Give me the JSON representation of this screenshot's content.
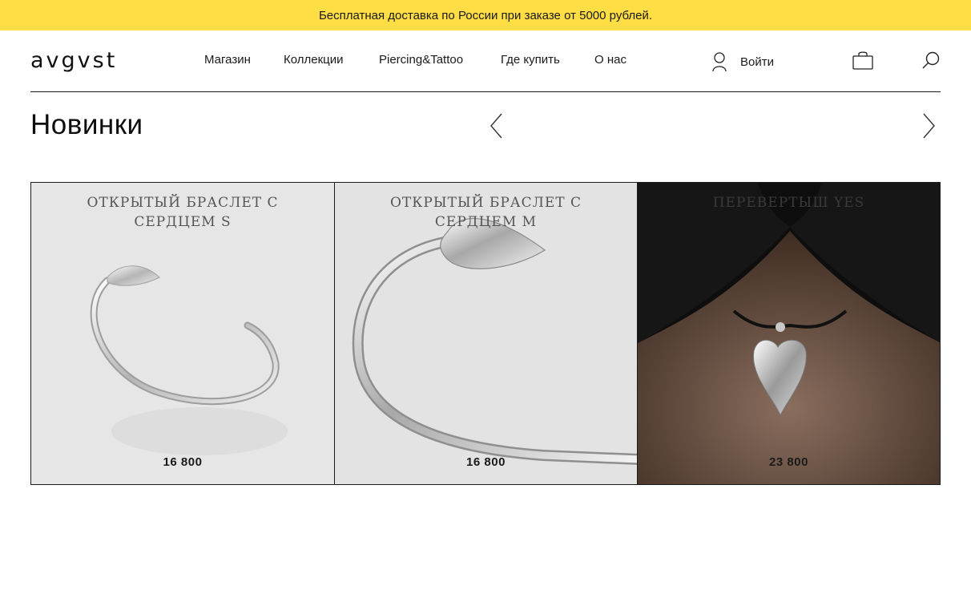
{
  "promo": {
    "text": "Бесплатная доставка по России при заказе от 5000 рублей."
  },
  "header": {
    "logo": "avgvst",
    "nav": [
      {
        "label": "Магазин"
      },
      {
        "label": "Коллекции"
      },
      {
        "label": "Piercing&Tattoo"
      },
      {
        "label": "Где купить"
      },
      {
        "label": "О нас"
      }
    ],
    "login_label": "Войти",
    "icons": {
      "user": "user-icon",
      "cart": "shopping-bag-icon",
      "search": "search-icon"
    }
  },
  "section": {
    "title": "Новинки",
    "prev_icon": "chevron-left-icon",
    "next_icon": "chevron-right-icon"
  },
  "products": [
    {
      "title": "Открытый браслет с сердцем S",
      "price": "16 800",
      "image": "silver-heart-cuff-bracelet"
    },
    {
      "title": "Открытый браслет с сердцем M",
      "price": "16 800",
      "image": "silver-heart-cuff-bracelet-closeup"
    },
    {
      "title": "Перевертыш Yes",
      "price": "23 800",
      "image": "silver-heart-pendant-on-neck"
    }
  ],
  "colors": {
    "promo_bg": "#ffdd45",
    "card_bg": "#e6e6e6",
    "text": "#111111"
  }
}
